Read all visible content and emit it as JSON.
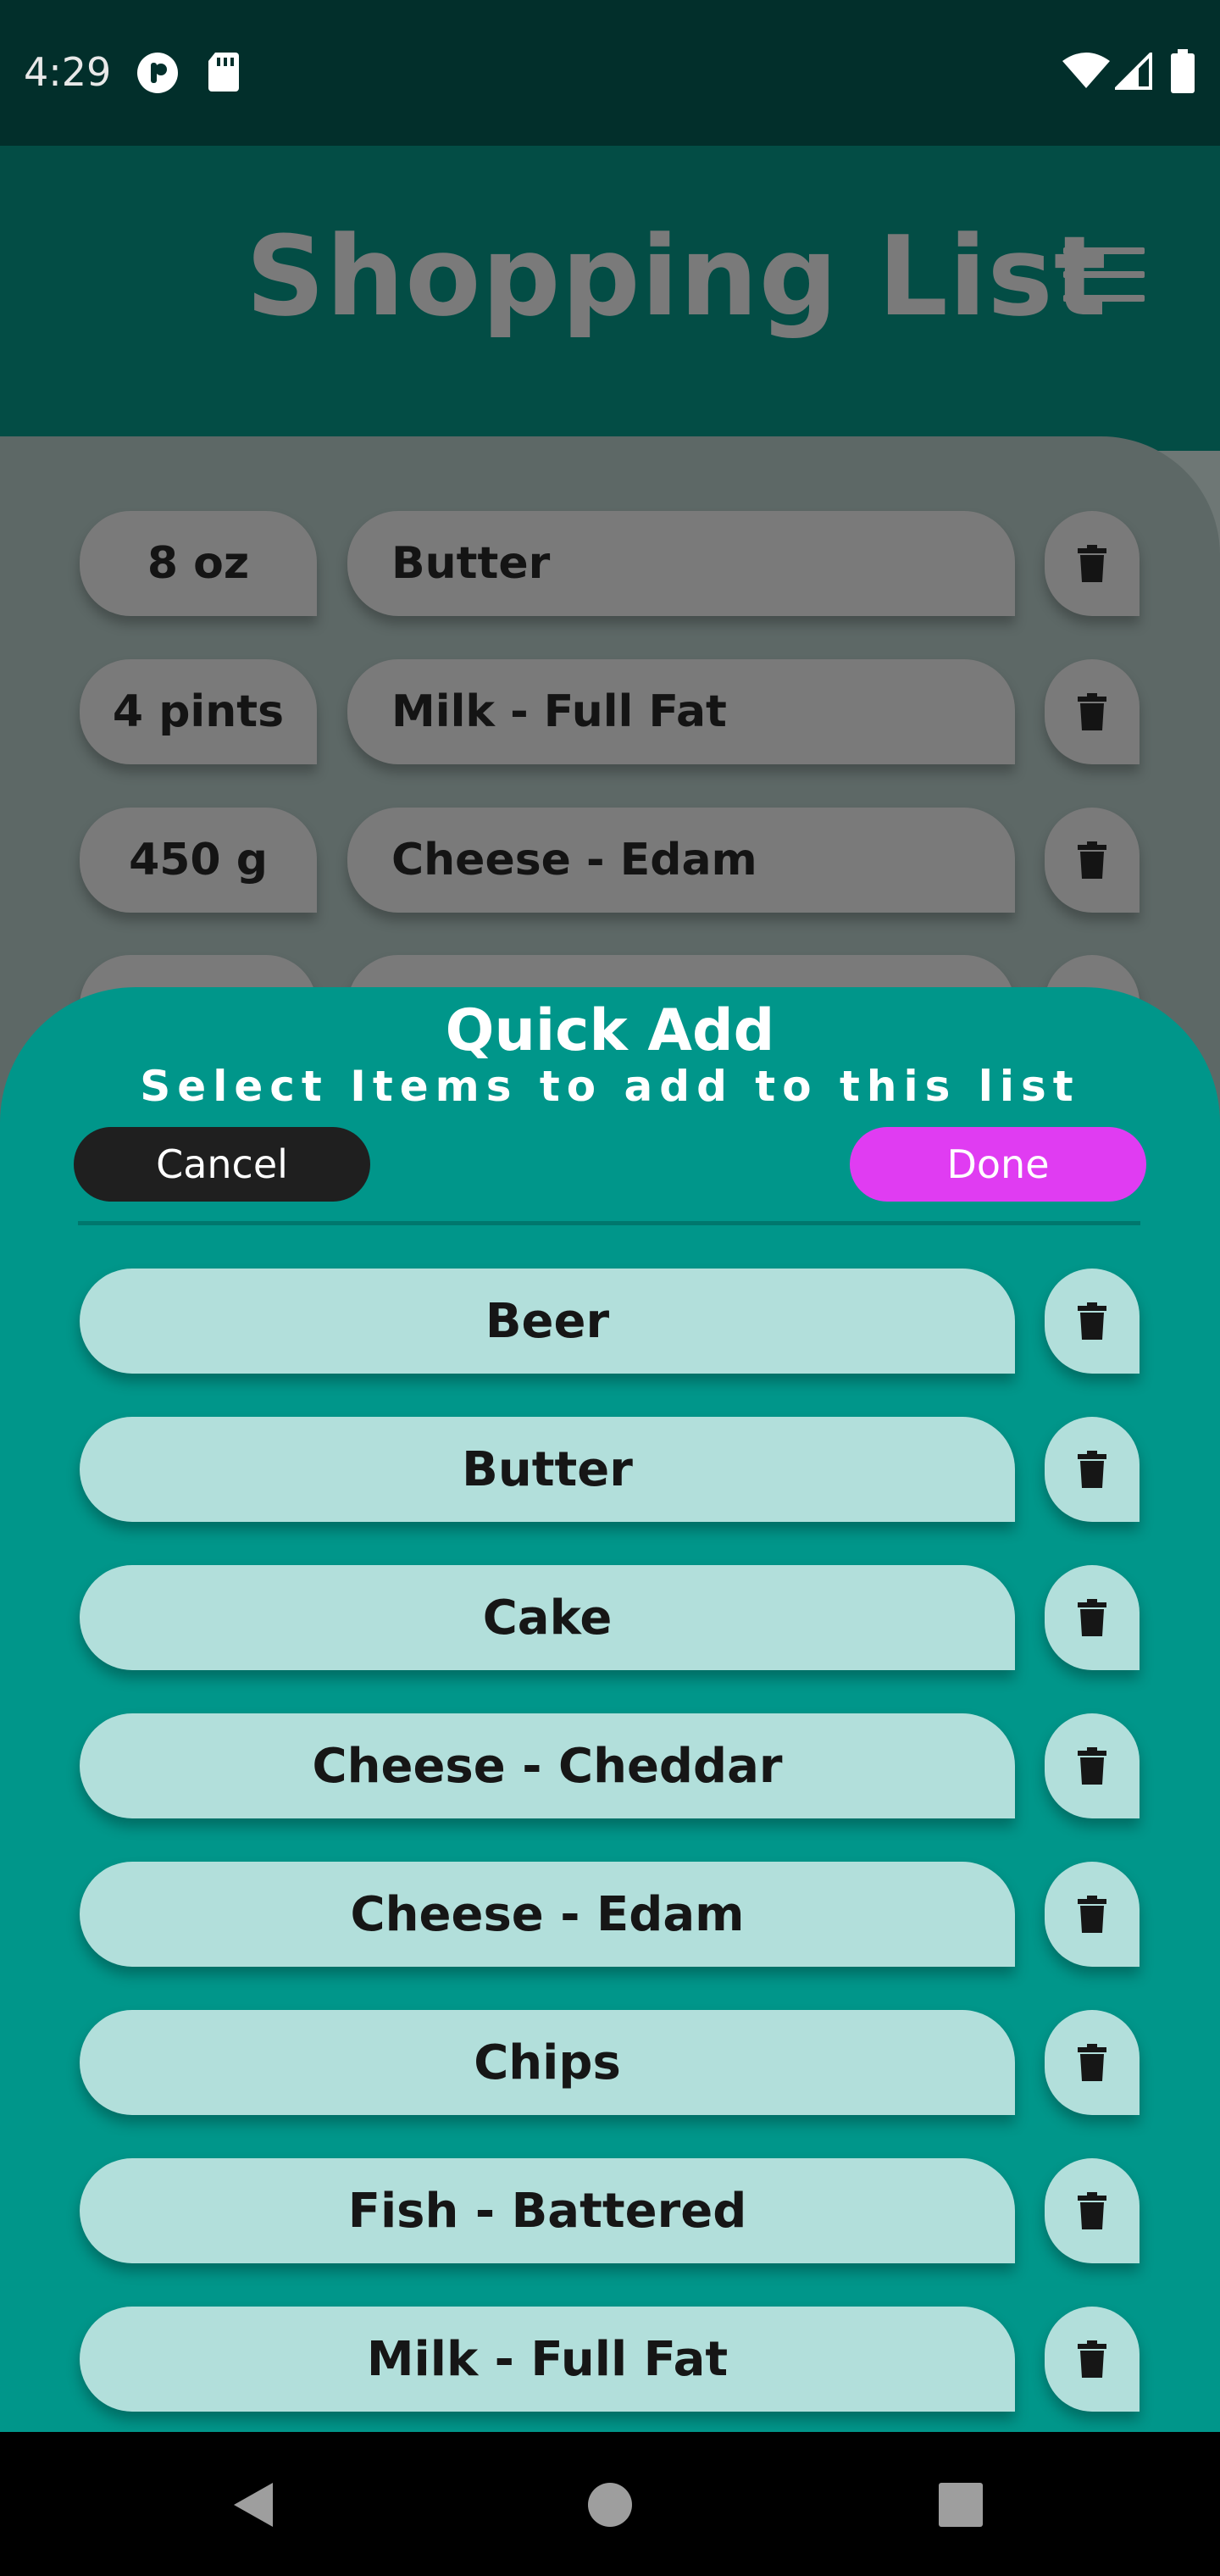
{
  "status_bar": {
    "time": "4:29",
    "icons_left": [
      "podcast-icon",
      "sd-card-icon"
    ],
    "icons_right": [
      "wifi-icon",
      "signal-icon",
      "battery-icon"
    ]
  },
  "app_bar": {
    "title": "Shopping List",
    "menu_icon": "hamburger-menu-icon"
  },
  "shopping_list": {
    "items": [
      {
        "quantity": "8 oz",
        "name": "Butter"
      },
      {
        "quantity": "4 pints",
        "name": "Milk - Full Fat"
      },
      {
        "quantity": "450 g",
        "name": "Cheese - Edam"
      }
    ]
  },
  "quick_add": {
    "title": "Quick Add",
    "subtitle": "Select Items to add to this list",
    "cancel_label": "Cancel",
    "done_label": "Done",
    "items": [
      "Beer",
      "Butter",
      "Cake",
      "Cheese - Cheddar",
      "Cheese - Edam",
      "Chips",
      "Fish - Battered",
      "Milk - Full Fat"
    ]
  },
  "nav_bar": {
    "icons": [
      "back-icon",
      "home-icon",
      "recents-icon"
    ]
  },
  "colors": {
    "status_bar": "#022f2b",
    "app_bar": "#034d45",
    "sheet": "#00968a",
    "item_bg": "#b2dfdb",
    "done_button": "#e03cf2",
    "cancel_button": "#1f1f1f"
  }
}
